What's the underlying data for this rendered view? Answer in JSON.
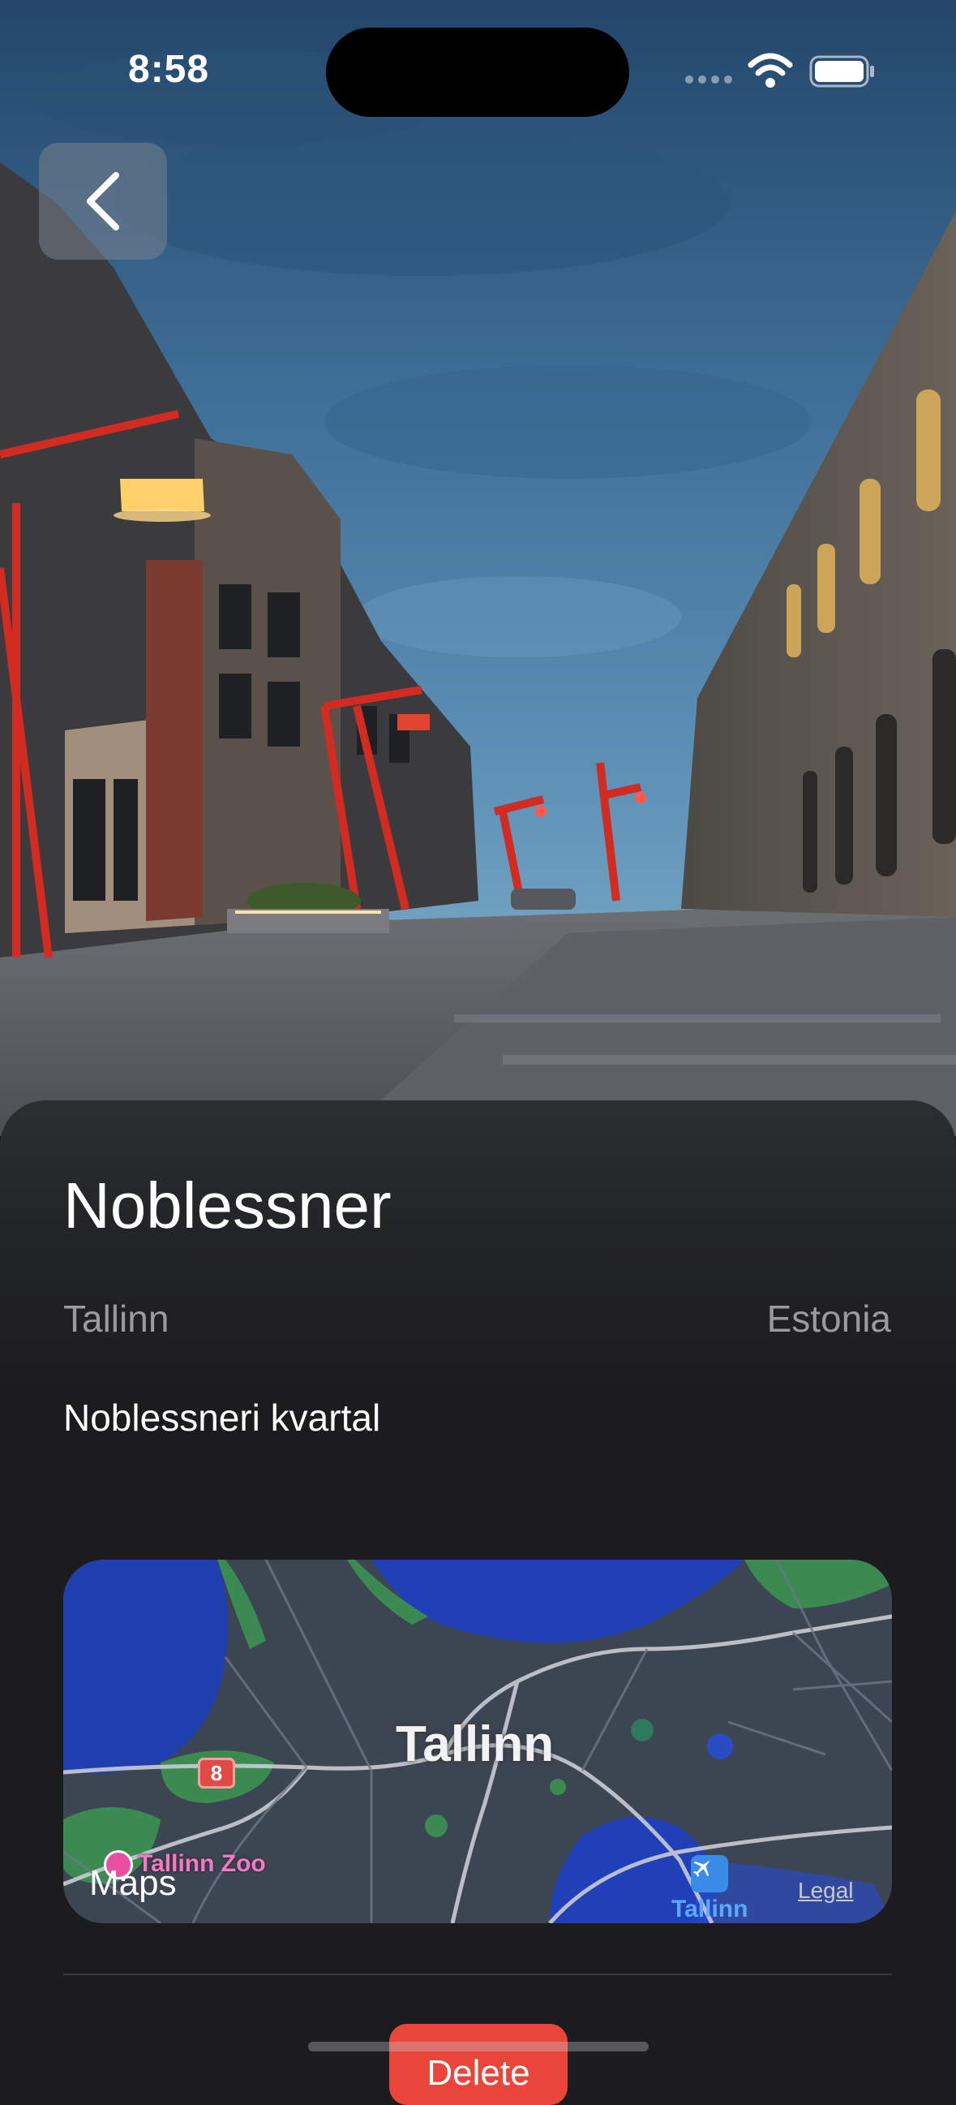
{
  "status_bar": {
    "time": "8:58"
  },
  "place": {
    "name": "Noblessner",
    "city": "Tallinn",
    "country": "Estonia",
    "district": "Noblessneri kvartal"
  },
  "map": {
    "city_label": "Tallinn",
    "route_number": "8",
    "poi_zoo": "Tallinn Zoo",
    "poi_airport": "Tallinn",
    "brand": "Maps",
    "legal": "Legal"
  },
  "actions": {
    "delete_label": "Delete"
  },
  "colors": {
    "delete": "#e9453a",
    "sheet": "#1c1c1e",
    "water": "#1f3fb0",
    "park": "#3c8a55"
  },
  "icons": {
    "back": "chevron-left-icon",
    "wifi": "wifi-icon",
    "battery": "battery-icon",
    "airport": "airplane-icon",
    "zoo": "zoo-icon",
    "apple": "apple-logo-icon"
  }
}
